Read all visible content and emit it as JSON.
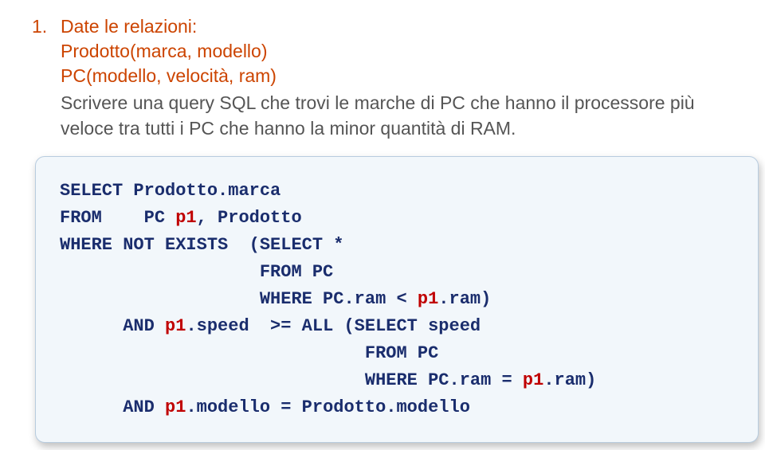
{
  "question": {
    "number": "1.",
    "prompt": "Date le relazioni:",
    "schema1": "Prodotto(marca, modello)",
    "schema2": "PC(modello, velocità, ram)",
    "body": "Scrivere una query SQL che trovi le marche di PC che hanno il processore più veloce tra tutti i PC che hanno la minor quantità di RAM."
  },
  "code": {
    "t": {
      "select": "SELECT",
      "prodotto_marca": " Prodotto.marca",
      "from": "FROM",
      "sp4": "    ",
      "pc_p1_prodotto": "PC ",
      "p1": "p1",
      "comma_prodotto": ", Prodotto",
      "where": "WHERE",
      "not_exists": " NOT EXISTS  (SELECT *",
      "pad1": "                   ",
      "from_pc1": "FROM PC",
      "pad2": "                   ",
      "where_pc_ram_lt": "WHERE PC.ram < ",
      "p1_ram_close": ".ram)",
      "pad_and1": "      ",
      "and": "AND ",
      "p1_speed": ".speed  >= ALL (SELECT speed",
      "pad_from2": "                             ",
      "from_pc2": "FROM PC",
      "pad_where2": "                             ",
      "where_pc_ram_eq": "WHERE PC.ram = ",
      "p1_ram_close2": ".ram)",
      "pad_and2": "      ",
      "and_p1_mod": ".modello = Prodotto.modello"
    }
  }
}
